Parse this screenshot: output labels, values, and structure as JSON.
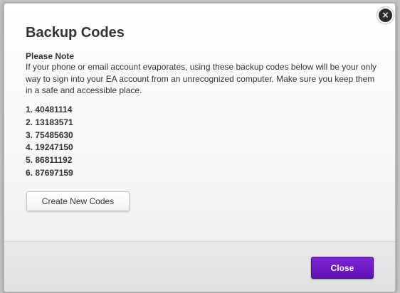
{
  "dialog": {
    "title": "Backup Codes",
    "close_icon_glyph": "×",
    "note_heading": "Please Note",
    "note_body": "If your phone or email account evaporates, using these backup codes below will be your only way to sign into your EA account from an unrecognized computer. Make sure you keep them in a safe and accessible place.",
    "codes": [
      "1. 40481114",
      "2. 13183571",
      "3. 75485630",
      "4. 19247150",
      "5. 86811192",
      "6. 87697159"
    ],
    "create_button_label": "Create New Codes",
    "close_button_label": "Close"
  },
  "colors": {
    "primary_button": "#6a1bc6",
    "close_icon_bg": "#2b2b2b",
    "text": "#333333"
  },
  "icons": {
    "close": "close-icon"
  }
}
